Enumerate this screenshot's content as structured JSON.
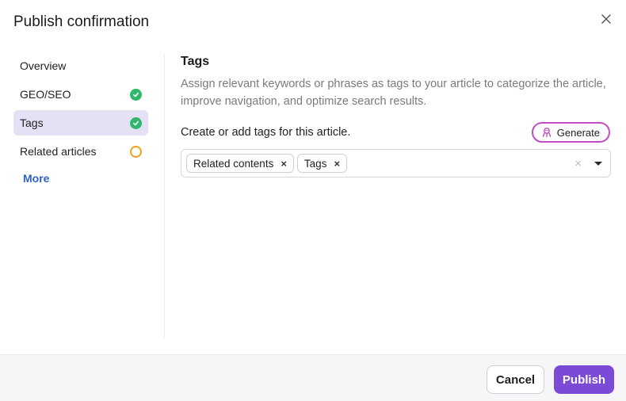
{
  "dialog": {
    "title": "Publish confirmation"
  },
  "sidebar": {
    "items": [
      {
        "label": "Overview",
        "status": "none"
      },
      {
        "label": "GEO/SEO",
        "status": "done"
      },
      {
        "label": "Tags",
        "status": "done",
        "active": true
      },
      {
        "label": "Related articles",
        "status": "pending"
      }
    ],
    "more_label": "More"
  },
  "main": {
    "section_title": "Tags",
    "description": "Assign relevant keywords or phrases as tags to your article to categorize the article, improve navigation, and optimize search results.",
    "tags_label": "Create or add tags for this article.",
    "generate_label": "Generate",
    "selected_tags": [
      "Related contents",
      "Tags"
    ]
  },
  "footer": {
    "cancel_label": "Cancel",
    "publish_label": "Publish"
  },
  "colors": {
    "accent": "#7b4bd6",
    "active_bg": "#e6e0f5",
    "done": "#2fb86b",
    "pending": "#f0a21b",
    "link": "#2f5fc4",
    "generate_border": "#c24dbf"
  },
  "icons": {
    "close": "close-icon",
    "done": "check-circle-icon",
    "pending": "circle-outline-icon",
    "generate": "ai-sparkle-icon",
    "chip_remove": "remove-icon",
    "clear": "clear-icon",
    "dropdown": "chevron-down-icon"
  }
}
